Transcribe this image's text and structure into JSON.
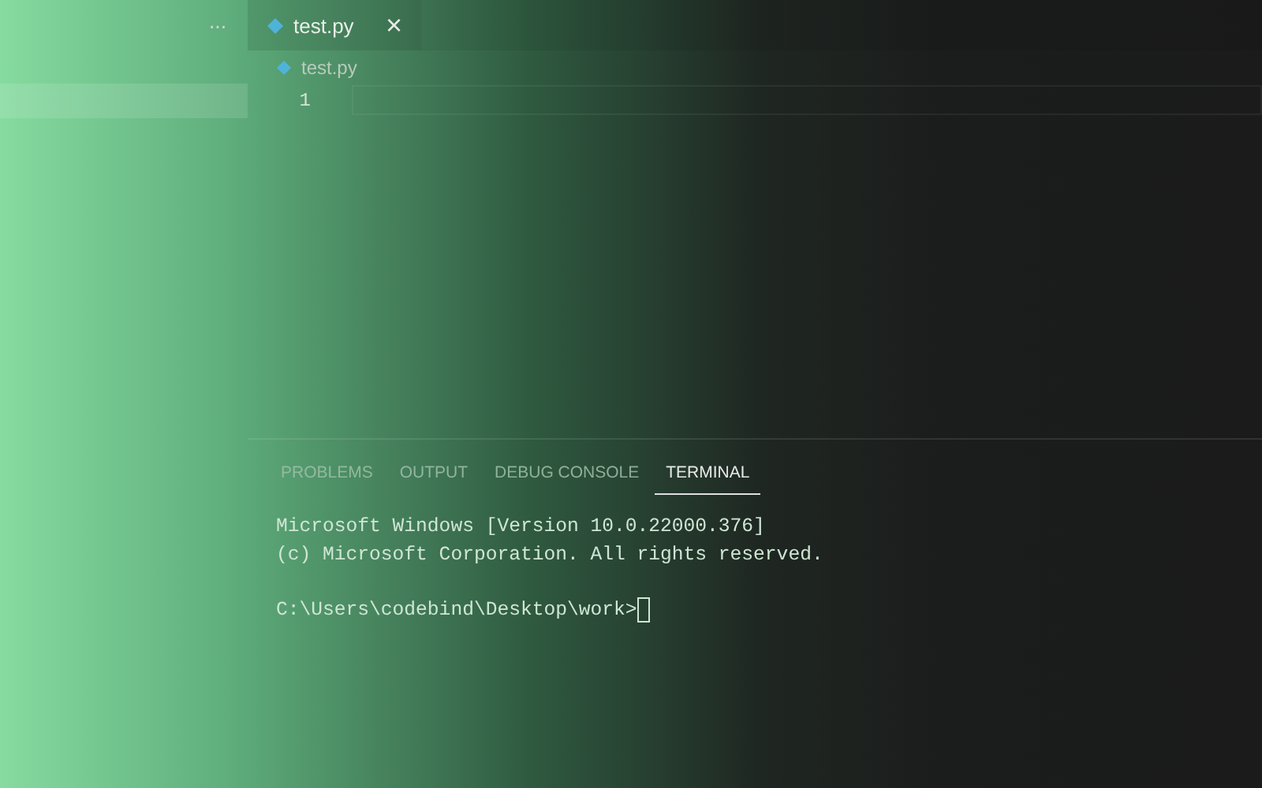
{
  "sidebar": {
    "more_button": "···"
  },
  "tabs": [
    {
      "label": "test.py",
      "selected": true,
      "close": "×"
    }
  ],
  "breadcrumb": "test.py",
  "editor": {
    "line_numbers": [
      "1"
    ]
  },
  "panel": {
    "tabs": [
      {
        "label": "PROBLEMS",
        "selected": false
      },
      {
        "label": "OUTPUT",
        "selected": false
      },
      {
        "label": "DEBUG CONSOLE",
        "selected": false
      },
      {
        "label": "TERMINAL",
        "selected": true
      }
    ],
    "terminal": {
      "lines": [
        "Microsoft Windows [Version 10.0.22000.376]",
        "(c) Microsoft Corporation. All rights reserved."
      ],
      "prompt": "C:\\Users\\codebind\\Desktop\\work>"
    }
  }
}
